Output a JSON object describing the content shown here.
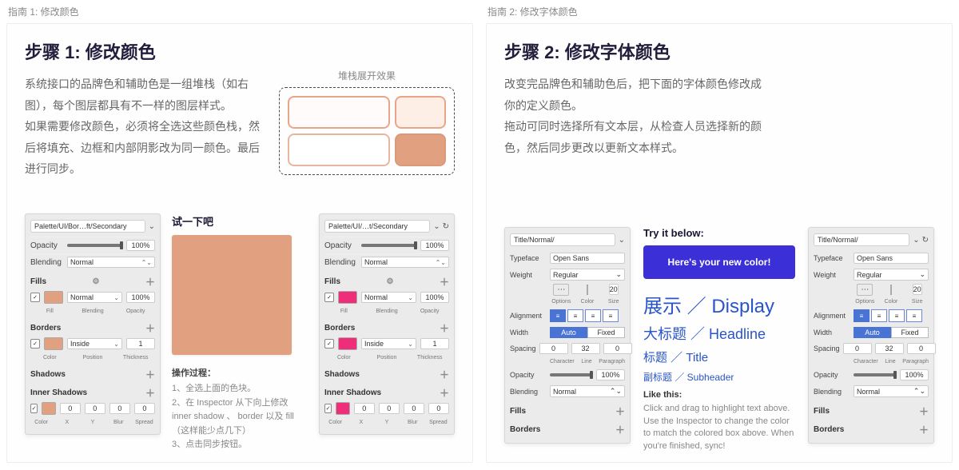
{
  "card1": {
    "tag": "指南 1: 修改颜色",
    "title": "步骤 1: 修改颜色",
    "desc_p1": "系统接口的品牌色和辅助色是一组堆栈（如右图），每个图层都具有不一样的图层样式。",
    "desc_p2": "如果需要修改颜色，必须将全选这些颜色栈，然后将填充、边框和内部阴影改为同一颜色。最后进行同步。",
    "stack_caption": "堆栈展开效果",
    "try_title": "试一下吧",
    "ops_title": "操作过程：",
    "ops1": "1、全选上面的色块。",
    "ops2": "2、在 Inspector 从下向上修改 inner shadow 、 border 以及 fill（这样能少点几下）",
    "ops3": "3、点击同步按钮。",
    "inspA": {
      "path": "Palette/UI/Bor…ft/Secondary",
      "opacity_label": "Opacity",
      "opacity_val": "100%",
      "blending_label": "Blending",
      "blending_val": "Normal",
      "fills_title": "Fills",
      "fill_mode": "Normal",
      "fill_opacity": "100%",
      "fill_lbl": "Fill",
      "blending_sub": "Blending",
      "opacity_sub": "Opacity",
      "borders_title": "Borders",
      "border_pos": "Inside",
      "border_thick": "1",
      "color_lbl": "Color",
      "position_lbl": "Position",
      "thickness_lbl": "Thickness",
      "shadows_title": "Shadows",
      "inner_title": "Inner Shadows",
      "ishadow_vals": [
        "0",
        "0",
        "0",
        "0"
      ],
      "ishadow_lbls": [
        "Color",
        "X",
        "Y",
        "Blur",
        "Spread"
      ],
      "fill_color": "#e1a080",
      "border_color": "#e1a080",
      "ishadow_color": "#e1a080"
    },
    "inspB": {
      "path": "Palette/UI/…t/Secondary",
      "fill_color": "#ef2e7a",
      "border_color": "#ef2e7a",
      "ishadow_color": "#ef2e7a"
    }
  },
  "card2": {
    "tag": "指南 2: 修改字体颜色",
    "title": "步骤 2: 修改字体颜色",
    "desc_p1": "改变完品牌色和辅助色后，把下面的字体颜色修改成你的定义颜色。",
    "desc_p2": "拖动可同时选择所有文本层，从检查人员选择新的颜色，然后同步更改以更新文本样式。",
    "try_title": "Try it below:",
    "new_color_label": "Here's your new color!",
    "typo": {
      "display": "展示 ／ Display",
      "headline": "大标题 ／ Headline",
      "title": "标题 ／ Title",
      "subheader": "副标题 ／ Subheader"
    },
    "like_this": "Like this:",
    "like_desc": "Click and drag to highlight text above. Use the Inspector to change the color to match the colored box above. When you're finished, sync!",
    "tinspA": {
      "path": "Title/Normal/",
      "typeface_lbl": "Typeface",
      "typeface_val": "Open Sans",
      "weight_lbl": "Weight",
      "weight_val": "Regular",
      "size_val": "20",
      "options_lbl": "Options",
      "color_lbl": "Color",
      "size_lbl": "Size",
      "alignment_lbl": "Alignment",
      "width_lbl": "Width",
      "width_auto": "Auto",
      "width_fixed": "Fixed",
      "spacing_lbl": "Spacing",
      "spacing_vals": [
        "0",
        "32",
        "0"
      ],
      "spacing_lbls": [
        "Character",
        "Line",
        "Paragraph"
      ],
      "opacity_lbl": "Opacity",
      "opacity_val": "100%",
      "blending_lbl": "Blending",
      "blending_val": "Normal",
      "fills_title": "Fills",
      "borders_title": "Borders",
      "color": "#0c216f"
    },
    "tinspB": {
      "color": "#e9271d"
    }
  }
}
